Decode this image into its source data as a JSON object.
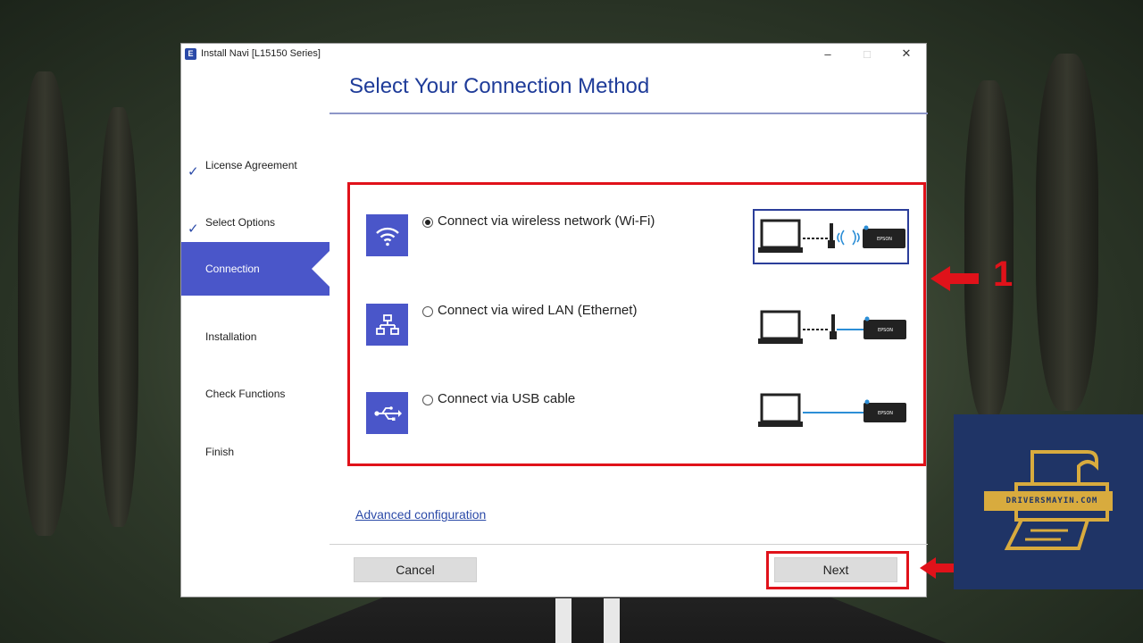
{
  "window": {
    "title": "Install Navi [L15150 Series]",
    "app_icon_letter": "E",
    "controls": {
      "minimize": "–",
      "maximize": "□",
      "close": "✕"
    }
  },
  "sidebar": {
    "steps": [
      {
        "label": "License Agreement",
        "state": "done",
        "check": "✓"
      },
      {
        "label": "Select Options",
        "state": "done",
        "check": "✓"
      },
      {
        "label": "Connection",
        "state": "active"
      },
      {
        "label": "Installation",
        "state": "pending"
      },
      {
        "label": "Check Functions",
        "state": "pending"
      },
      {
        "label": "Finish",
        "state": "pending"
      }
    ]
  },
  "main": {
    "heading": "Select Your Connection Method",
    "options": [
      {
        "label": "Connect via wireless network (Wi-Fi)",
        "icon": "wifi-icon",
        "selected": true
      },
      {
        "label": "Connect via wired LAN (Ethernet)",
        "icon": "network-icon",
        "selected": false
      },
      {
        "label": "Connect via USB cable",
        "icon": "usb-icon",
        "selected": false
      }
    ],
    "printer_label": "EPSON",
    "advanced_link": "Advanced configuration"
  },
  "footer": {
    "cancel_label": "Cancel",
    "next_label": "Next"
  },
  "annotations": {
    "number": "1",
    "color": "#e0121a"
  },
  "logo": {
    "text": "DRIVERSMAYIN.COM",
    "bg_color": "#1f3466",
    "fg_color": "#d8ab3e"
  },
  "colors": {
    "accent": "#4a56c9",
    "heading": "#1f3c99",
    "link": "#2b4aa8"
  }
}
